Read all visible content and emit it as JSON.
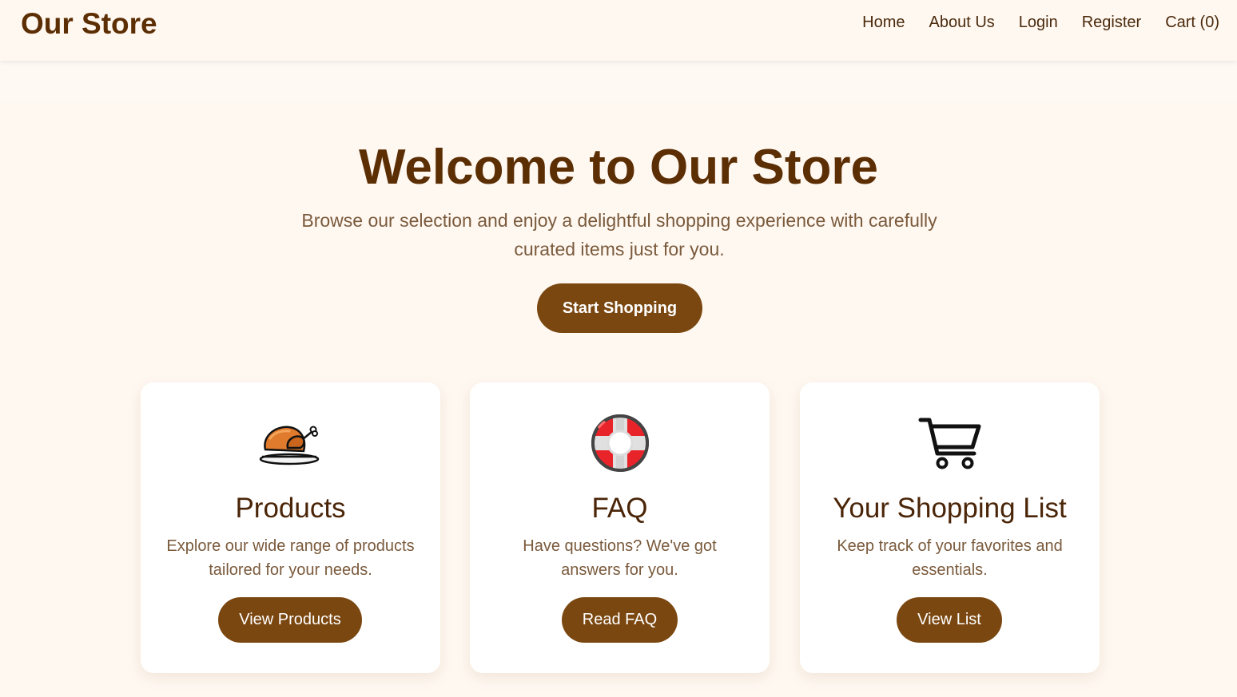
{
  "header": {
    "brand": "Our Store",
    "nav": {
      "home": "Home",
      "about": "About Us",
      "login": "Login",
      "register": "Register",
      "cart": "Cart (0)"
    }
  },
  "hero": {
    "title": "Welcome to Our Store",
    "subtitle": "Browse our selection and enjoy a delightful shopping experience with carefully curated items just for you.",
    "cta_label": "Start Shopping"
  },
  "cards": [
    {
      "icon": "roast-turkey-icon",
      "title": "Products",
      "description": "Explore our wide range of products tailored for your needs.",
      "button_label": "View Products"
    },
    {
      "icon": "lifebuoy-icon",
      "title": "FAQ",
      "description": "Have questions? We've got answers for you.",
      "button_label": "Read FAQ"
    },
    {
      "icon": "shopping-cart-icon",
      "title": "Your Shopping List",
      "description": "Keep track of your favorites and essentials.",
      "button_label": "View List"
    }
  ],
  "colors": {
    "background": "#fff8f1",
    "brand_brown": "#5c2e04",
    "button_brown": "#7b4710",
    "text_muted": "#7a5a3c",
    "card_bg": "#ffffff"
  }
}
